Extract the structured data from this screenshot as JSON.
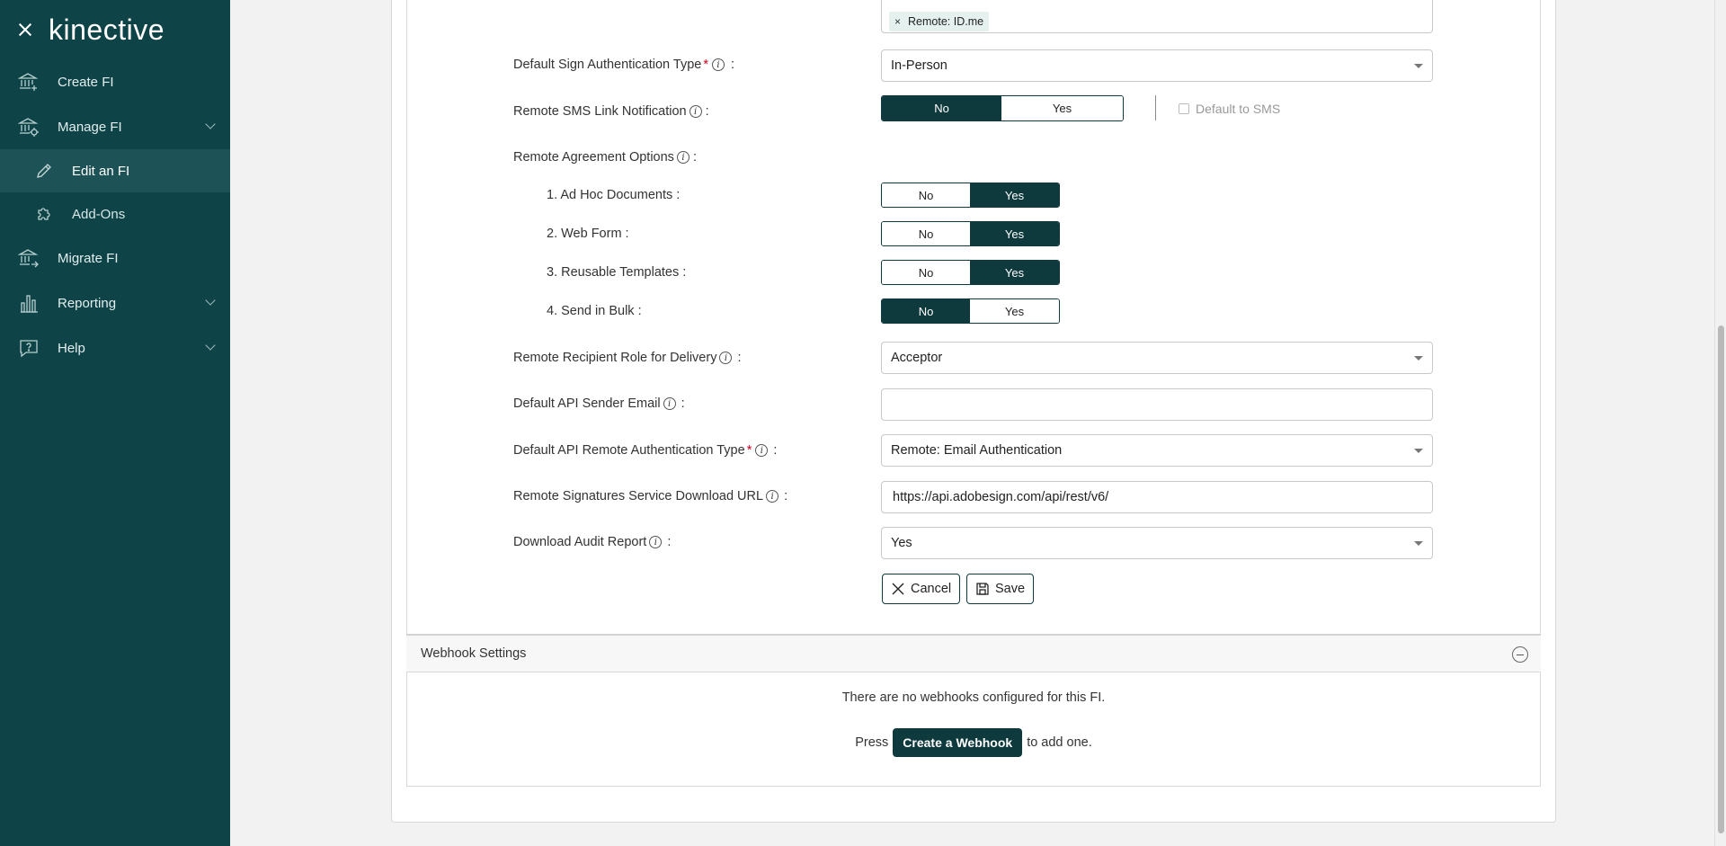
{
  "brand": {
    "logo": "kinective"
  },
  "sidebar": {
    "items": [
      {
        "label": "Create FI"
      },
      {
        "label": "Manage FI"
      },
      {
        "label": "Edit an FI"
      },
      {
        "label": "Add-Ons"
      },
      {
        "label": "Migrate FI"
      },
      {
        "label": "Reporting"
      },
      {
        "label": "Help"
      }
    ]
  },
  "form": {
    "auth_tag": "Remote: ID.me",
    "default_sign_auth": {
      "label": "Default Sign Authentication Type",
      "value": "In-Person"
    },
    "remote_sms": {
      "label": "Remote SMS Link Notification",
      "no": "No",
      "yes": "Yes",
      "selected": "No",
      "checkbox_label": "Default to SMS"
    },
    "remote_agreement": {
      "label": "Remote Agreement Options"
    },
    "options": [
      {
        "label": "1. Ad Hoc Documents :",
        "no": "No",
        "yes": "Yes",
        "selected": "Yes"
      },
      {
        "label": "2. Web Form :",
        "no": "No",
        "yes": "Yes",
        "selected": "Yes"
      },
      {
        "label": "3. Reusable Templates :",
        "no": "No",
        "yes": "Yes",
        "selected": "Yes"
      },
      {
        "label": "4. Send in Bulk :",
        "no": "No",
        "yes": "Yes",
        "selected": "No"
      }
    ],
    "recipient_role": {
      "label": "Remote Recipient Role for Delivery",
      "value": "Acceptor"
    },
    "api_sender_email": {
      "label": "Default API Sender Email",
      "value": ""
    },
    "api_remote_auth": {
      "label": "Default API Remote Authentication Type",
      "value": "Remote: Email Authentication"
    },
    "download_url": {
      "label": "Remote Signatures Service Download URL",
      "value": "https://api.adobesign.com/api/rest/v6/"
    },
    "audit_report": {
      "label": "Download Audit Report",
      "value": "Yes"
    },
    "info_glyph": "i",
    "colon": ":",
    "required_mark": "*",
    "cancel_label": "Cancel",
    "save_label": "Save"
  },
  "webhooks": {
    "title": "Webhook Settings",
    "empty_text": "There are no webhooks configured for this FI.",
    "press": "Press",
    "create_button": "Create a Webhook",
    "suffix": "to add one."
  },
  "colors": {
    "sidebar": "#0e4448",
    "accent": "#0e3a3e",
    "active_item": "#1d5256"
  }
}
